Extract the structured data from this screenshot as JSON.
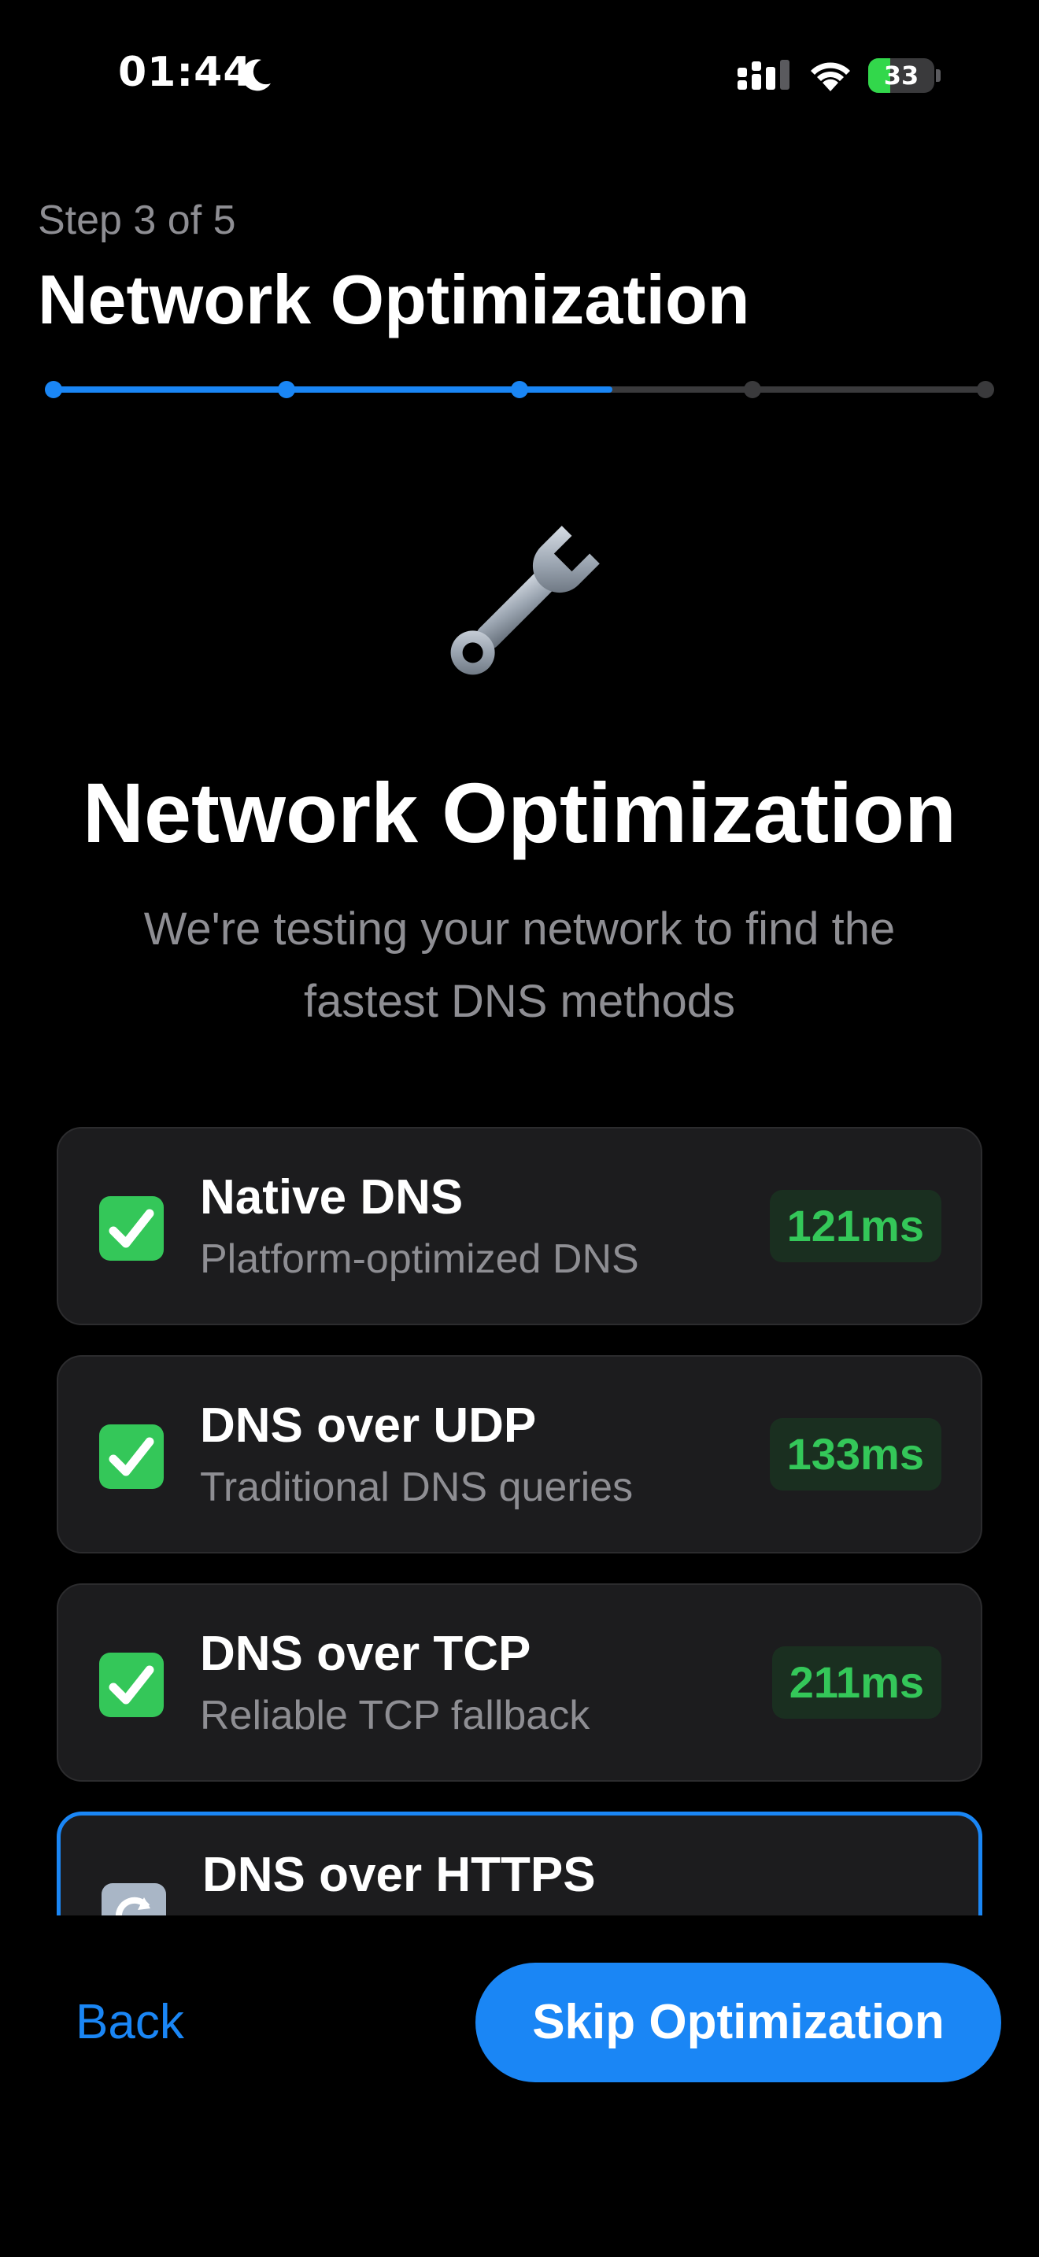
{
  "status_bar": {
    "time": "01:44",
    "battery": "33",
    "battery_level": 0.33,
    "icons": [
      "moon-icon",
      "signal-icon",
      "wifi-icon",
      "battery-icon"
    ]
  },
  "header": {
    "step_label": "Step 3 of 5",
    "title": "Network Optimization",
    "progress": {
      "current_step": 3,
      "total_steps": 5,
      "fraction": 0.6
    }
  },
  "hero": {
    "icon": "wrench-icon",
    "title": "Network Optimization",
    "subtitle": "We're testing your network to find the fastest DNS methods"
  },
  "methods": [
    {
      "name": "Native DNS",
      "description": "Platform-optimized DNS",
      "latency": "121ms",
      "status": "done"
    },
    {
      "name": "DNS over UDP",
      "description": "Traditional DNS queries",
      "latency": "133ms",
      "status": "done"
    },
    {
      "name": "DNS over TCP",
      "description": "Reliable TCP fallback",
      "latency": "211ms",
      "status": "done"
    },
    {
      "name": "DNS over HTTPS",
      "status": "testing"
    }
  ],
  "footer": {
    "back_label": "Back",
    "skip_label": "Skip Optimization"
  },
  "colors": {
    "accent": "#1a86f5",
    "success": "#34c759",
    "background": "#000000",
    "card": "#1c1c1e",
    "secondary_text": "#8e8e93"
  }
}
